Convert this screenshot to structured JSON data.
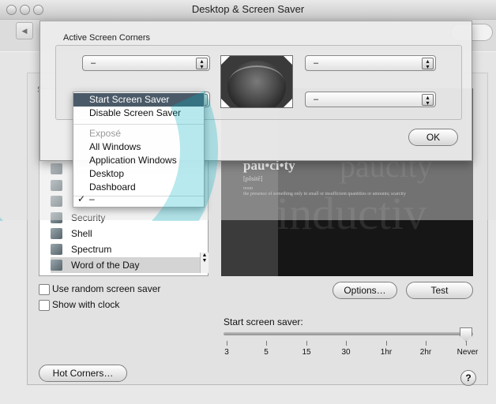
{
  "window": {
    "title": "Desktop & Screen Saver"
  },
  "sheet": {
    "title": "Active Screen Corners",
    "corners": {
      "top_left": "–",
      "top_right": "–",
      "bottom_left": "",
      "bottom_right": "–"
    },
    "ok_label": "OK"
  },
  "corner_menu": {
    "items": [
      {
        "label": "Start Screen Saver",
        "state": "highlighted"
      },
      {
        "label": "Disable Screen Saver",
        "state": "normal"
      },
      {
        "label": "Exposé",
        "state": "disabled"
      },
      {
        "label": "All Windows",
        "state": "normal"
      },
      {
        "label": "Application Windows",
        "state": "normal"
      },
      {
        "label": "Desktop",
        "state": "normal"
      },
      {
        "label": "Dashboard",
        "state": "normal"
      },
      {
        "label": "–",
        "state": "checked",
        "check": "✓"
      }
    ]
  },
  "sidebar": {
    "partial_label": "S",
    "list": [
      {
        "label": "Security",
        "selected": false
      },
      {
        "label": "Shell",
        "selected": false
      },
      {
        "label": "Spectrum",
        "selected": false
      },
      {
        "label": "Word of the Day",
        "selected": true
      }
    ]
  },
  "preview": {
    "word": "pau•ci•ty",
    "pronunciation": "[pôsitē]",
    "part_of_speech": "noun",
    "definition": "the presence of something only in small or insufficient quantities or amounts; scarcity",
    "ghost_word_1": "paucity",
    "ghost_word_2": "inductiv"
  },
  "options": {
    "random_label": "Use random screen saver",
    "random_checked": false,
    "clock_label": "Show with clock",
    "clock_checked": false
  },
  "buttons": {
    "options": "Options…",
    "test": "Test",
    "hot_corners": "Hot Corners…",
    "help": "?"
  },
  "slider": {
    "label": "Start screen saver:",
    "ticks": [
      "3",
      "5",
      "15",
      "30",
      "1hr",
      "2hr",
      "Never"
    ],
    "value": "Never"
  },
  "colors": {
    "highlight": "#4b5a68",
    "watermark": "#00b0c3"
  },
  "icons": [
    "back-arrow-icon",
    "popup-arrows-icon",
    "screensaver-icon",
    "help-icon"
  ]
}
